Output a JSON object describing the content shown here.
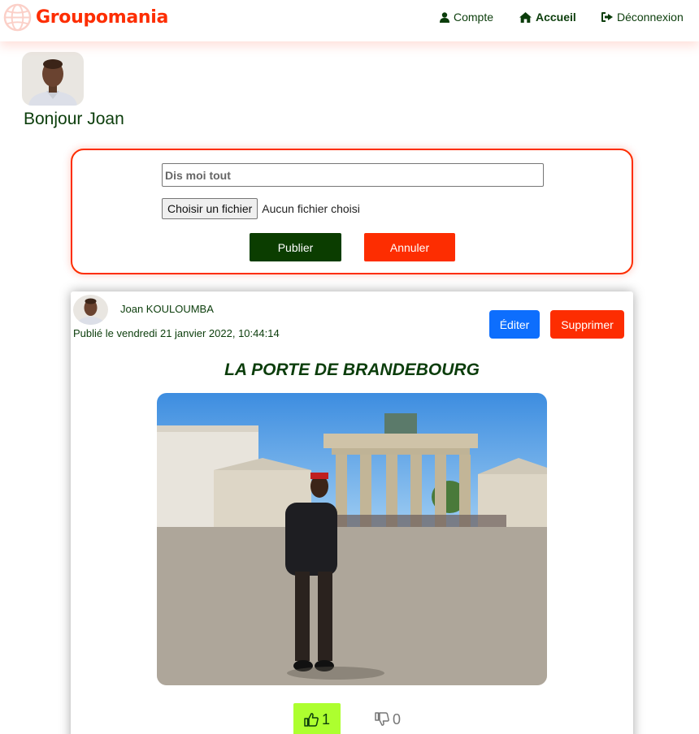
{
  "app": {
    "name": "Groupomania",
    "brand_color": "#fd2d01",
    "dark_green": "#0b3d0b"
  },
  "nav": {
    "account_label": "Compte",
    "home_label": "Accueil",
    "logout_label": "Déconnexion"
  },
  "profile": {
    "greeting": "Bonjour Joan"
  },
  "create_post": {
    "placeholder": "Dis moi tout",
    "file_button_label": "Choisir un fichier",
    "file_status": "Aucun fichier choisi",
    "publish_label": "Publier",
    "cancel_label": "Annuler"
  },
  "post": {
    "author": "Joan KOULOUMBA",
    "published": "Publié le vendredi 21 janvier 2022, 10:44:14",
    "edit_label": "Éditer",
    "delete_label": "Supprimer",
    "title": "LA PORTE DE BRANDEBOURG",
    "likes": "1",
    "dislikes": "0"
  }
}
